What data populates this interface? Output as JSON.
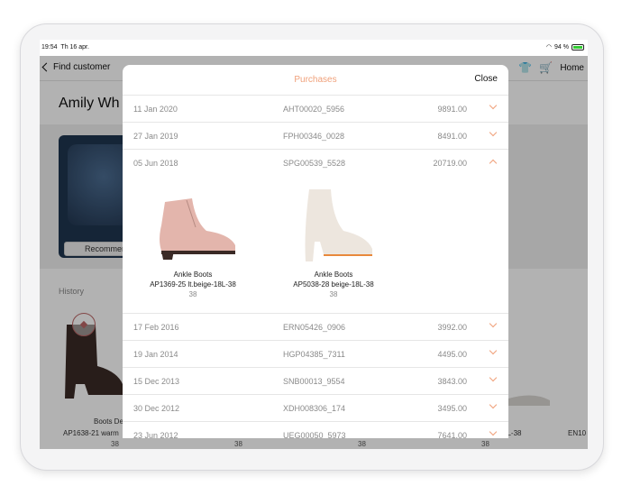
{
  "status": {
    "time": "19:54",
    "date": "Th 16 apr.",
    "battery": "94 %"
  },
  "nav": {
    "back_label": "Find customer",
    "home_label": "Home"
  },
  "customer": {
    "name": "Amily Wh",
    "promo_button": "Recommend"
  },
  "history": {
    "label": "History",
    "item_name": "Boots De",
    "item_article": "AP1638-21 warm",
    "right_article": "8L-38",
    "right_article2": "EN10",
    "sizes": [
      "38",
      "38",
      "38",
      "38"
    ]
  },
  "modal": {
    "title": "Purchases",
    "close_label": "Close",
    "rows_before": [
      {
        "date": "11 Jan 2020",
        "order": "AHT00020_5956",
        "amount": "9891.00"
      },
      {
        "date": "27 Jan 2019",
        "order": "FPH00346_0028",
        "amount": "8491.00"
      },
      {
        "date": "05 Jun 2018",
        "order": "SPG00539_5528",
        "amount": "20719.00"
      }
    ],
    "expanded_items": [
      {
        "name": "Ankle Boots",
        "article": "AP1369-25 lt.beige-18L-38",
        "size": "38"
      },
      {
        "name": "Ankle Boots",
        "article": "AP5038-28 beige-18L-38",
        "size": "38"
      }
    ],
    "rows_after": [
      {
        "date": "17 Feb 2016",
        "order": "ERN05426_0906",
        "amount": "3992.00"
      },
      {
        "date": "19 Jan 2014",
        "order": "HGP04385_7311",
        "amount": "4495.00"
      },
      {
        "date": "15 Dec 2013",
        "order": "SNB00013_9554",
        "amount": "3843.00"
      },
      {
        "date": "30 Dec 2012",
        "order": "XDH008306_174",
        "amount": "3495.00"
      },
      {
        "date": "23 Jun 2012",
        "order": "UEG00050_5973",
        "amount": "7641.00"
      }
    ]
  },
  "colors": {
    "accent": "#f0a07a",
    "dim_overlay": "rgba(0,0,0,0.3)"
  }
}
